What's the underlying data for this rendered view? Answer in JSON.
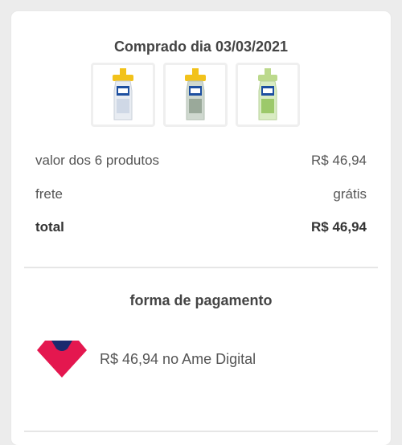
{
  "purchase": {
    "title": "Comprado dia 03/03/2021",
    "products": [
      {
        "icon": "cleaner-bottle-yellow-icon",
        "cap_color": "#f2c21b",
        "label_color": "#1d4fa0",
        "body_color": "#e8ecf2"
      },
      {
        "icon": "cleaner-bottle-green-icon",
        "cap_color": "#f2c21b",
        "label_color": "#1d4fa0",
        "body_color": "#cfd8cf"
      },
      {
        "icon": "cleaner-bottle-lime-icon",
        "cap_color": "#bcd98c",
        "label_color": "#1d4fa0",
        "body_color": "#d9ecc3"
      }
    ]
  },
  "summary": {
    "products_label": "valor dos 6 produtos",
    "products_value": "R$ 46,94",
    "shipping_label": "frete",
    "shipping_value": "grátis",
    "total_label": "total",
    "total_value": "R$ 46,94"
  },
  "payment": {
    "title": "forma de pagamento",
    "method_text": "R$ 46,94 no Ame Digital",
    "logo_icon": "ame-digital-logo",
    "logo_colors": {
      "pink": "#e4174f",
      "navy": "#1a2a6e"
    }
  }
}
